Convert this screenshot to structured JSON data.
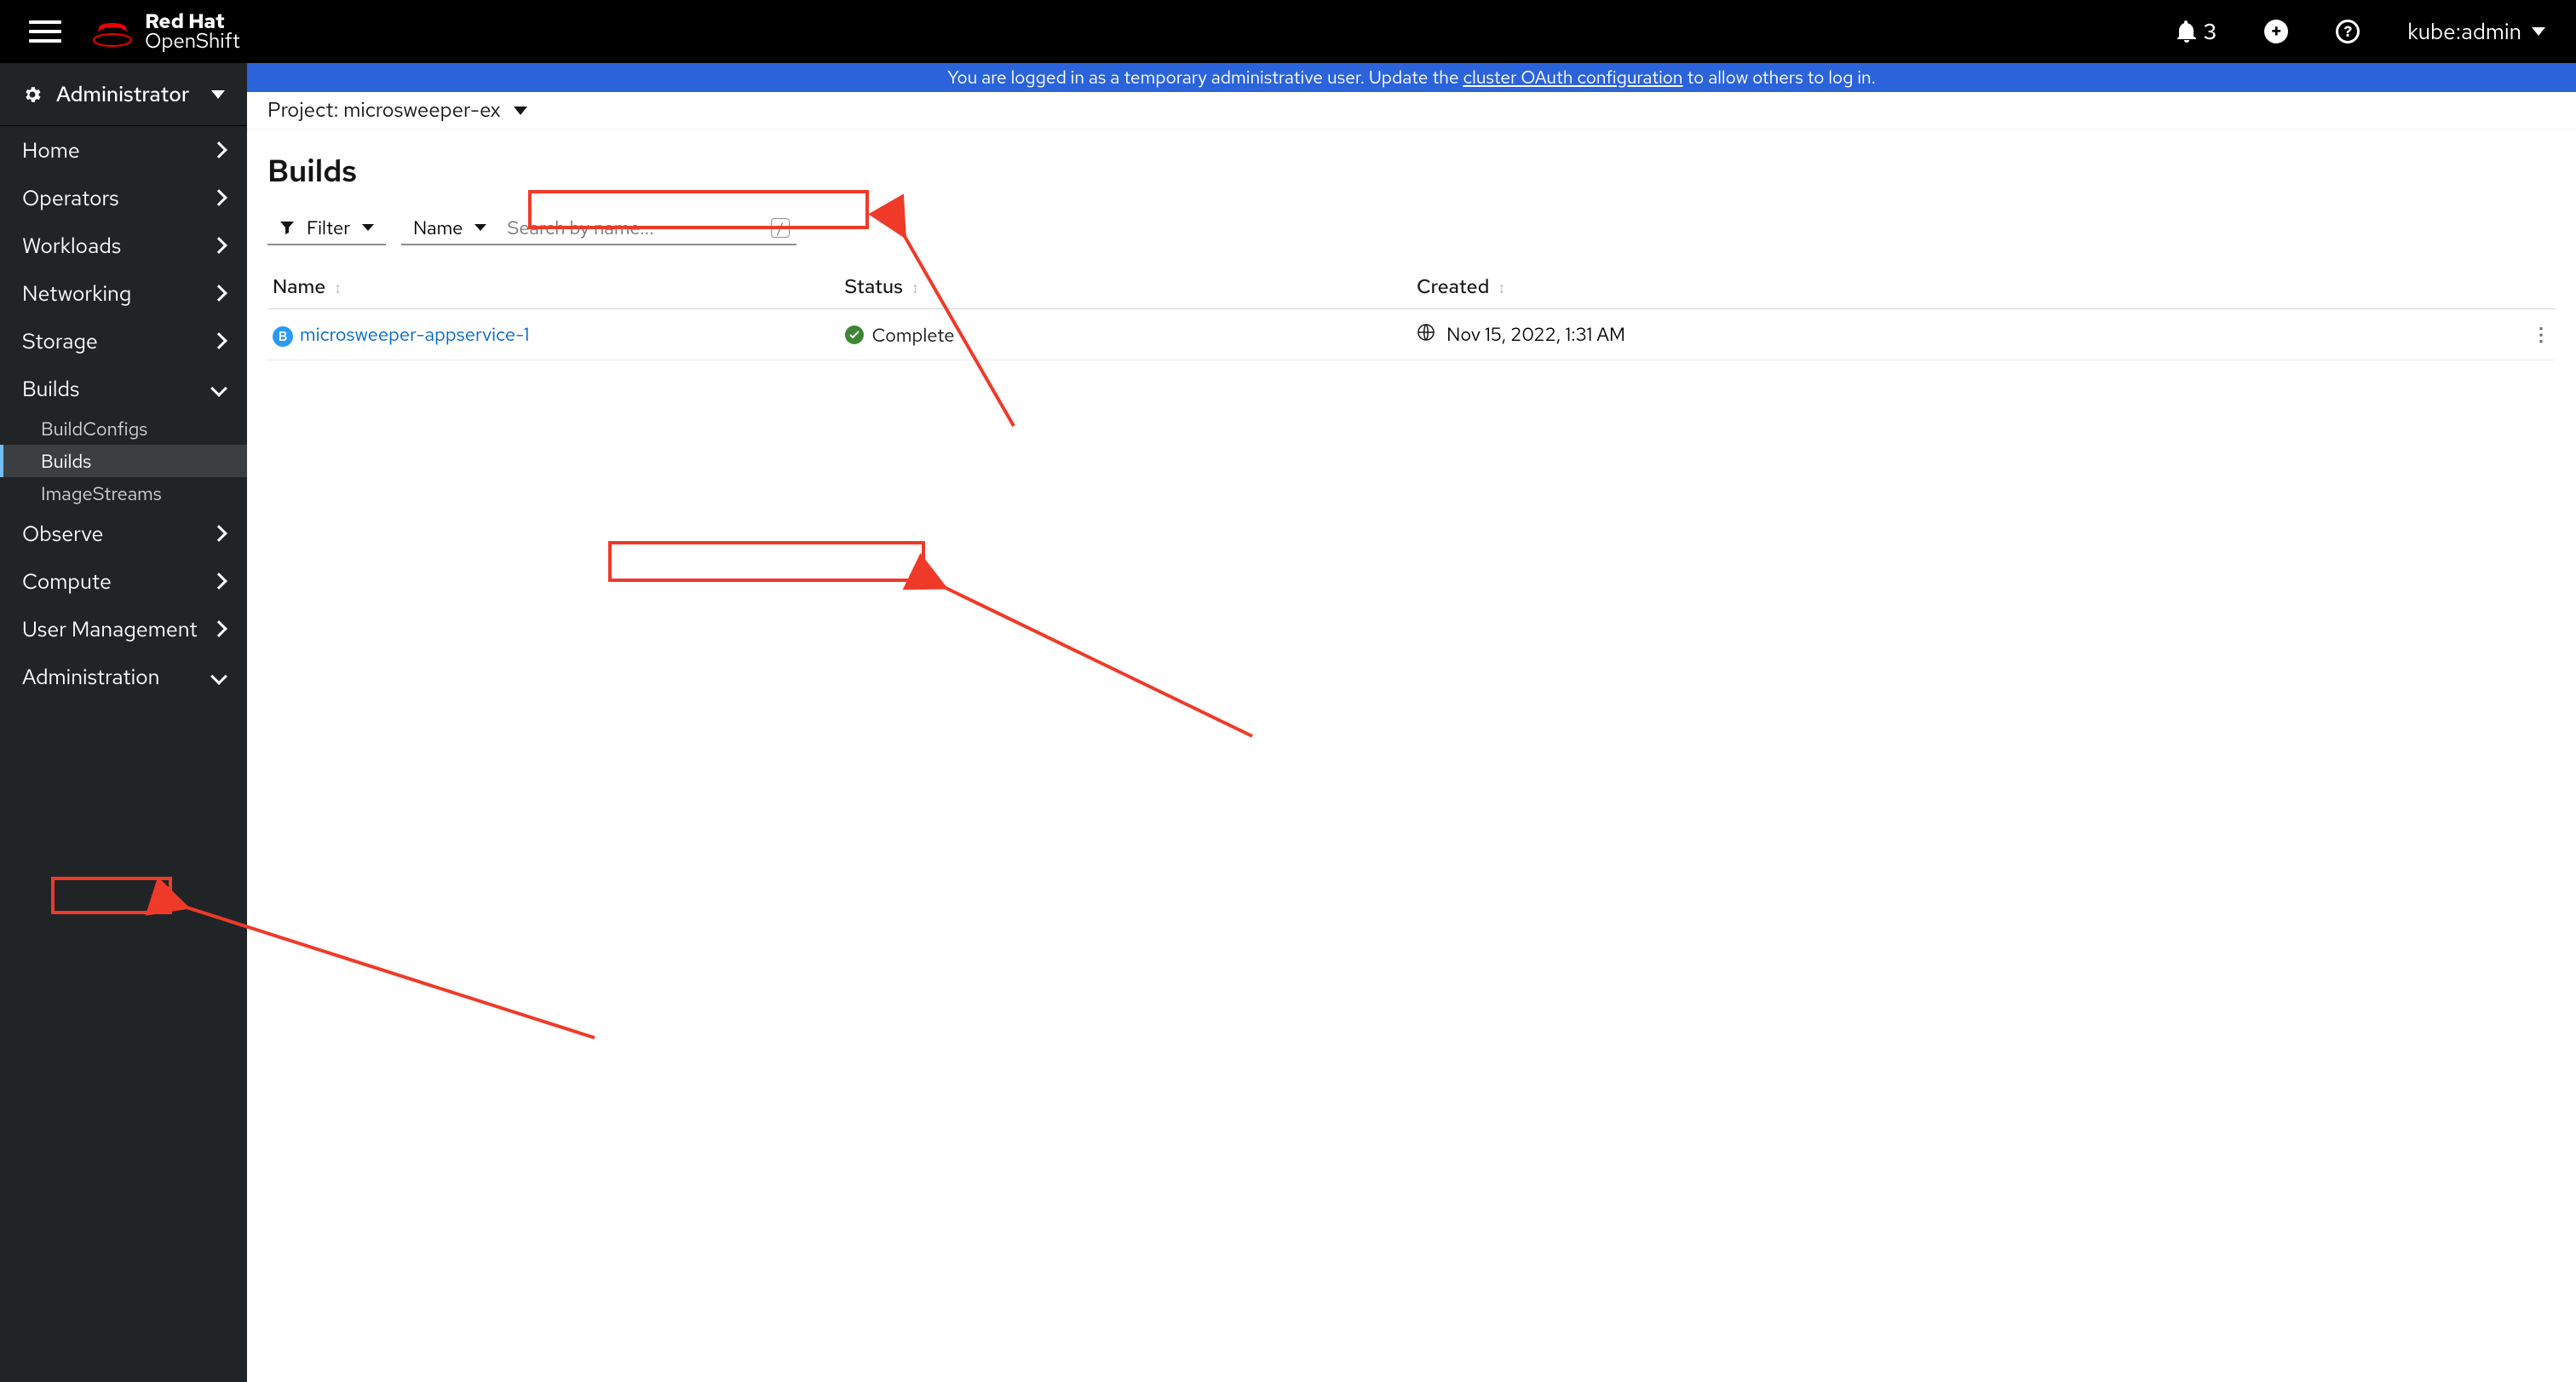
{
  "brand": {
    "line1": "Red Hat",
    "line2": "OpenShift"
  },
  "topbar": {
    "notif_count": "3",
    "user": "kube:admin"
  },
  "perspective": {
    "label": "Administrator"
  },
  "nav": {
    "items": [
      {
        "label": "Home",
        "expandable": true,
        "open": false
      },
      {
        "label": "Operators",
        "expandable": true,
        "open": false
      },
      {
        "label": "Workloads",
        "expandable": true,
        "open": false
      },
      {
        "label": "Networking",
        "expandable": true,
        "open": false
      },
      {
        "label": "Storage",
        "expandable": true,
        "open": false
      },
      {
        "label": "Builds",
        "expandable": true,
        "open": true,
        "subitems": [
          {
            "label": "BuildConfigs",
            "selected": false
          },
          {
            "label": "Builds",
            "selected": true
          },
          {
            "label": "ImageStreams",
            "selected": false
          }
        ]
      },
      {
        "label": "Observe",
        "expandable": true,
        "open": false
      },
      {
        "label": "Compute",
        "expandable": true,
        "open": false
      },
      {
        "label": "User Management",
        "expandable": true,
        "open": false
      },
      {
        "label": "Administration",
        "expandable": true,
        "open": true
      }
    ]
  },
  "banner": {
    "prefix": "You are logged in as a temporary administrative user. Update the ",
    "link": "cluster OAuth configuration",
    "suffix": " to allow others to log in."
  },
  "project": {
    "label": "Project: microsweeper-ex"
  },
  "page": {
    "title": "Builds"
  },
  "toolbar": {
    "filter_label": "Filter",
    "name_label": "Name",
    "search_placeholder": "Search by name...",
    "kbd": "/"
  },
  "table": {
    "headers": {
      "name": "Name",
      "status": "Status",
      "created": "Created"
    },
    "rows": [
      {
        "badge": "B",
        "name": "microsweeper-appservice-1",
        "status": "Complete",
        "created": "Nov 15, 2022, 1:31 AM"
      }
    ]
  }
}
